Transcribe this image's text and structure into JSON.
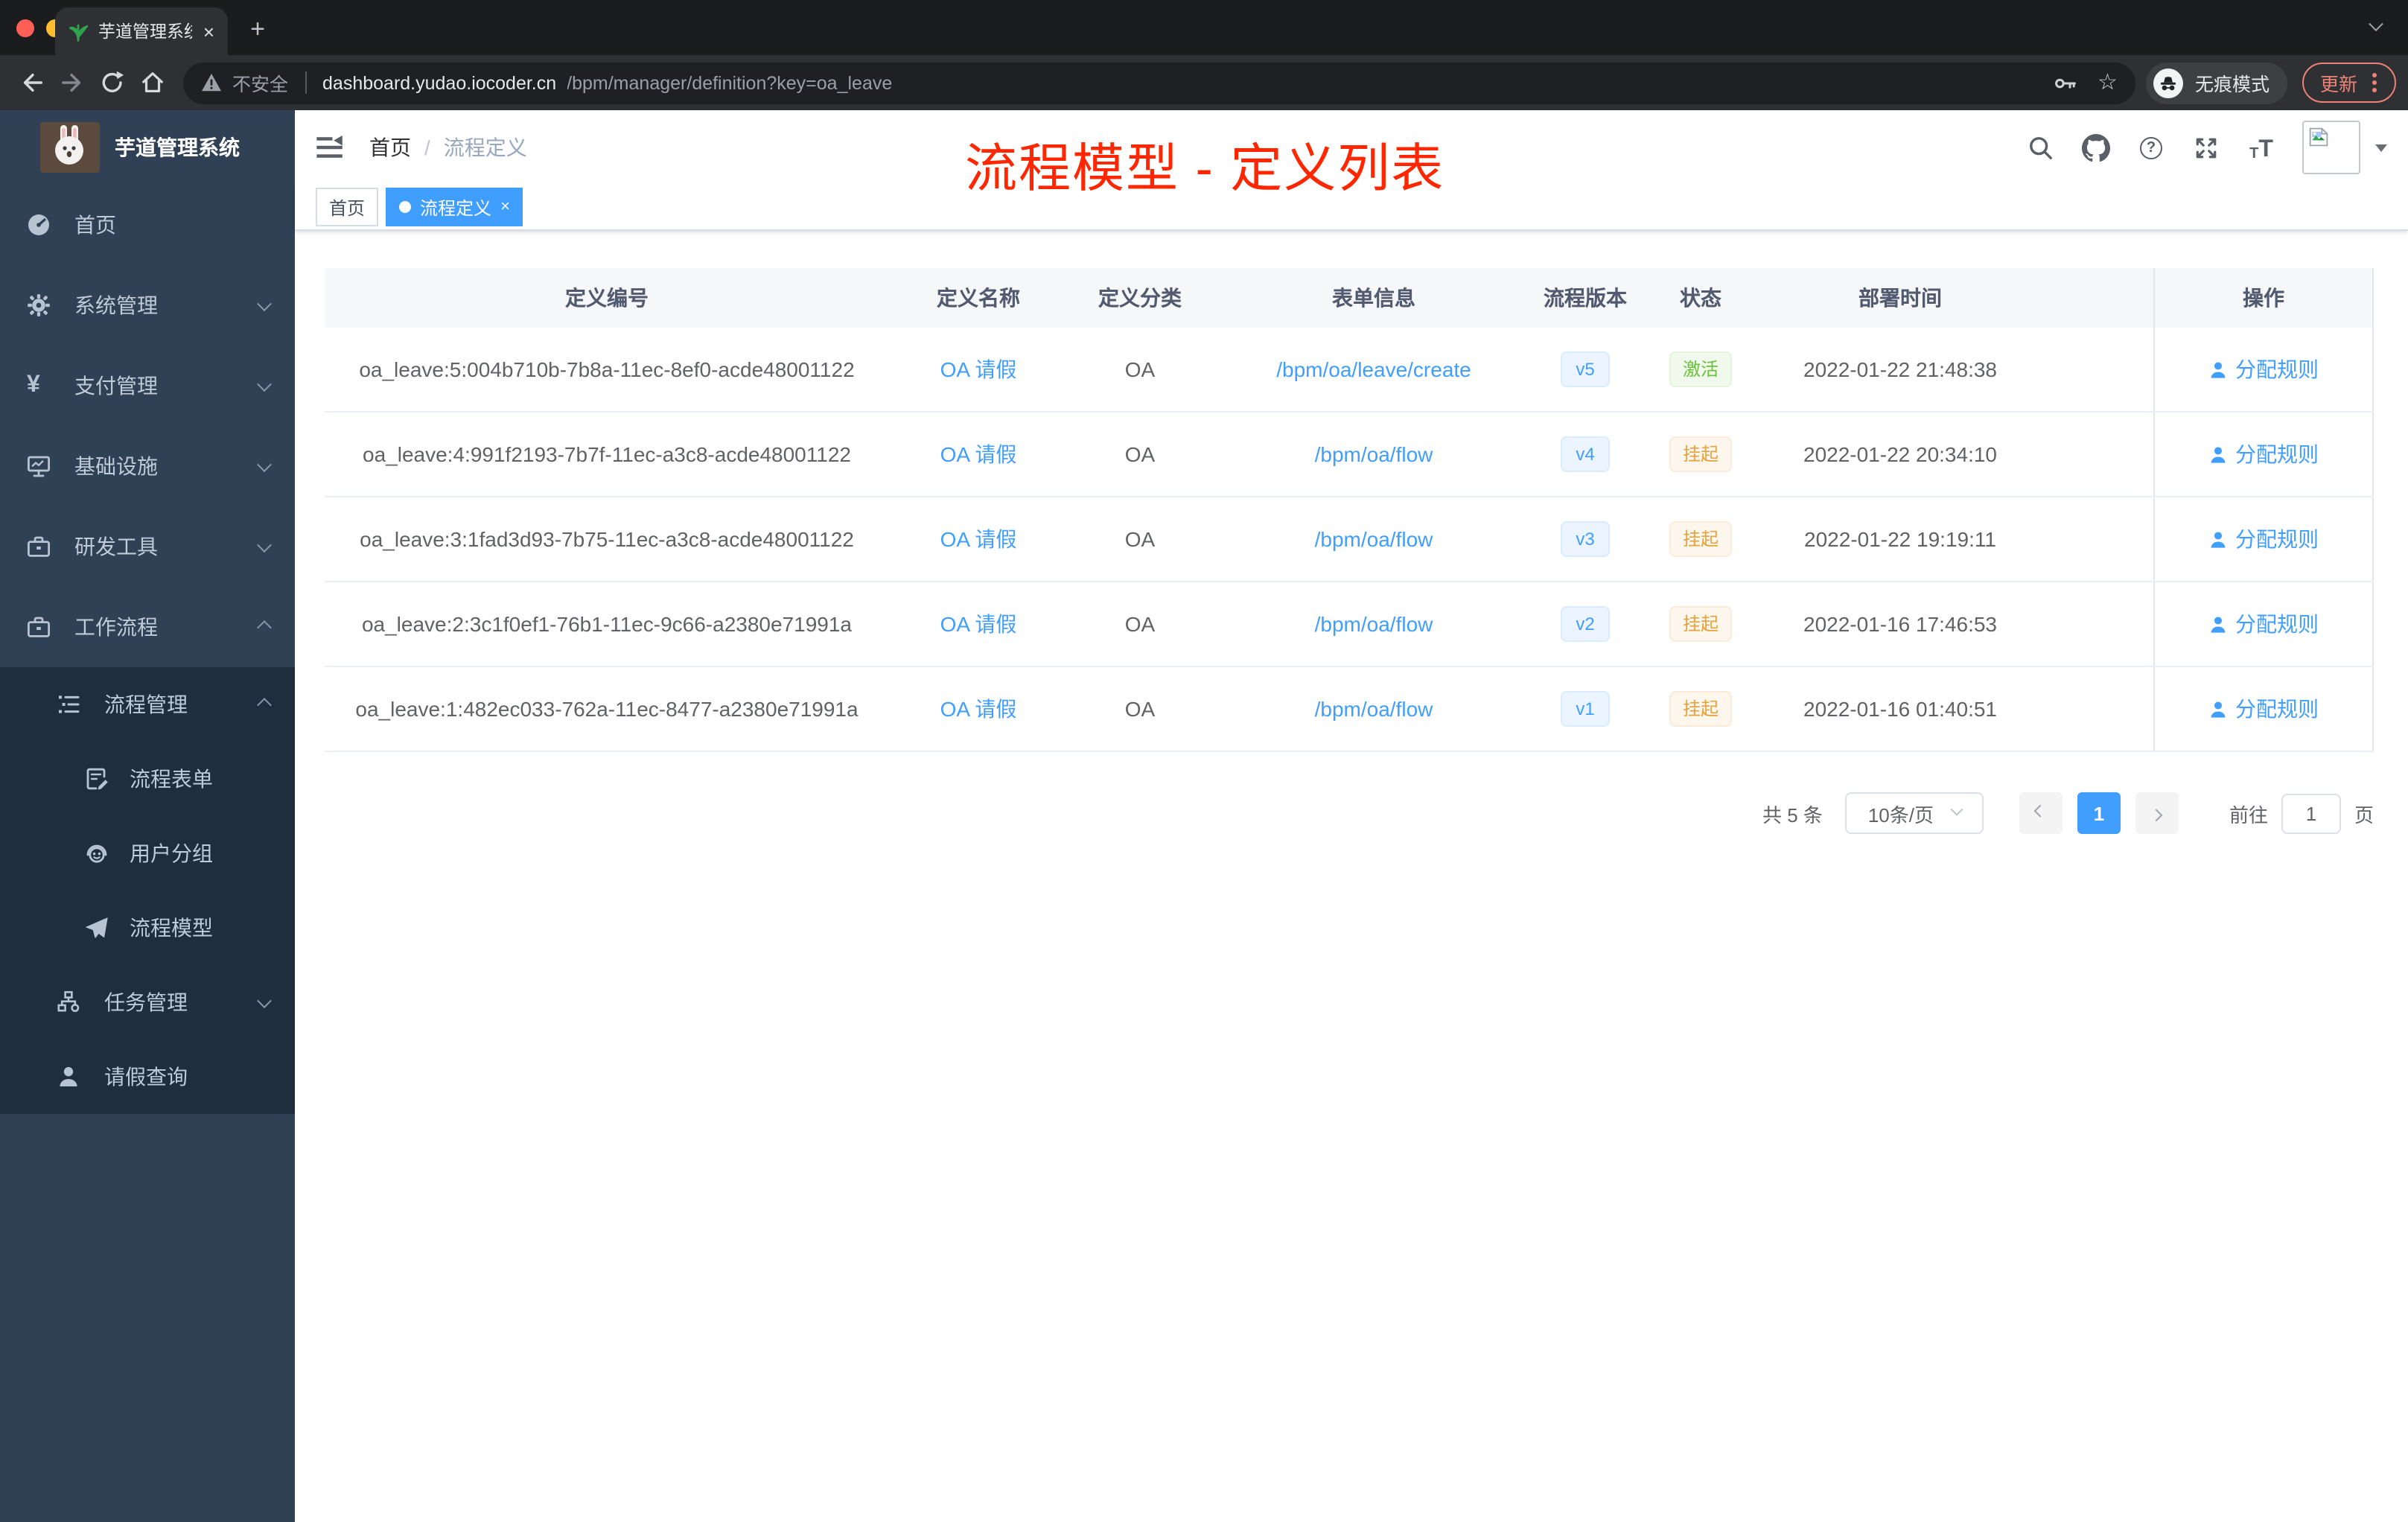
{
  "colors": {
    "accent": "#409eff",
    "success": "#67c23a",
    "warning": "#e6a23c",
    "annotation_red": "#ff2600",
    "sidebar_bg": "#304156",
    "submenu_bg": "#1f2d3d"
  },
  "icons": {
    "favicon": "green-seedling",
    "traffic_lights": "close-minimize-maximize",
    "security": "warning-triangle",
    "key": "key-glyph",
    "bookmark": "star-outline",
    "incognito": "hat-and-glasses",
    "menu_dots": "vertical-ellipsis",
    "hamburger": "fold-outdent",
    "header_icons": [
      "search-magnifier",
      "github-octocat",
      "question-circle",
      "fullscreen-arrows",
      "font-size-Tt"
    ],
    "avatar": "broken-image-placeholder",
    "sidebar_icons": [
      "dashboard-gauge",
      "gear",
      "yen-sign",
      "monitor-chart",
      "toolbox",
      "toolbox",
      "tree-list",
      "form-edit",
      "face-people",
      "paper-plane",
      "org-tree",
      "user-solid"
    ],
    "action_icon": "user-solid-blue"
  },
  "browser": {
    "tab_title": "芋道管理系统",
    "security": "不安全",
    "url_host": "dashboard.yudao.iocoder.cn",
    "url_path": "/bpm/manager/definition?key=oa_leave",
    "incognito": "无痕模式",
    "update": "更新"
  },
  "sidebar": {
    "title": "芋道管理系统",
    "home": "首页",
    "system": "系统管理",
    "pay": "支付管理",
    "infra": "基础设施",
    "devtools": "研发工具",
    "workflow": "工作流程",
    "process_mgmt": "流程管理",
    "process_form": "流程表单",
    "user_group": "用户分组",
    "process_model": "流程模型",
    "task_mgmt": "任务管理",
    "leave_query": "请假查询"
  },
  "header": {
    "breadcrumb_home": "首页",
    "breadcrumb_sep": "/",
    "breadcrumb_current": "流程定义",
    "annotation": "流程模型 - 定义列表"
  },
  "tags": {
    "home": "首页",
    "current": "流程定义"
  },
  "table": {
    "columns": [
      "定义编号",
      "定义名称",
      "定义分类",
      "表单信息",
      "流程版本",
      "状态",
      "部署时间",
      "操作"
    ],
    "rows": [
      {
        "id": "oa_leave:5:004b710b-7b8a-11ec-8ef0-acde48001122",
        "name": "OA 请假",
        "category": "OA",
        "form": "/bpm/oa/leave/create",
        "version": "v5",
        "status": "激活",
        "status_type": "success",
        "time": "2022-01-22 21:48:38",
        "action": "分配规则"
      },
      {
        "id": "oa_leave:4:991f2193-7b7f-11ec-a3c8-acde48001122",
        "name": "OA 请假",
        "category": "OA",
        "form": "/bpm/oa/flow",
        "version": "v4",
        "status": "挂起",
        "status_type": "warning",
        "time": "2022-01-22 20:34:10",
        "action": "分配规则"
      },
      {
        "id": "oa_leave:3:1fad3d93-7b75-11ec-a3c8-acde48001122",
        "name": "OA 请假",
        "category": "OA",
        "form": "/bpm/oa/flow",
        "version": "v3",
        "status": "挂起",
        "status_type": "warning",
        "time": "2022-01-22 19:19:11",
        "action": "分配规则"
      },
      {
        "id": "oa_leave:2:3c1f0ef1-76b1-11ec-9c66-a2380e71991a",
        "name": "OA 请假",
        "category": "OA",
        "form": "/bpm/oa/flow",
        "version": "v2",
        "status": "挂起",
        "status_type": "warning",
        "time": "2022-01-16 17:46:53",
        "action": "分配规则"
      },
      {
        "id": "oa_leave:1:482ec033-762a-11ec-8477-a2380e71991a",
        "name": "OA 请假",
        "category": "OA",
        "form": "/bpm/oa/flow",
        "version": "v1",
        "status": "挂起",
        "status_type": "warning",
        "time": "2022-01-16 01:40:51",
        "action": "分配规则"
      }
    ]
  },
  "pagination": {
    "total": "共 5 条",
    "page_size": "10条/页",
    "page": "1",
    "jump_prefix": "前往",
    "jump_value": "1",
    "jump_suffix": "页"
  }
}
